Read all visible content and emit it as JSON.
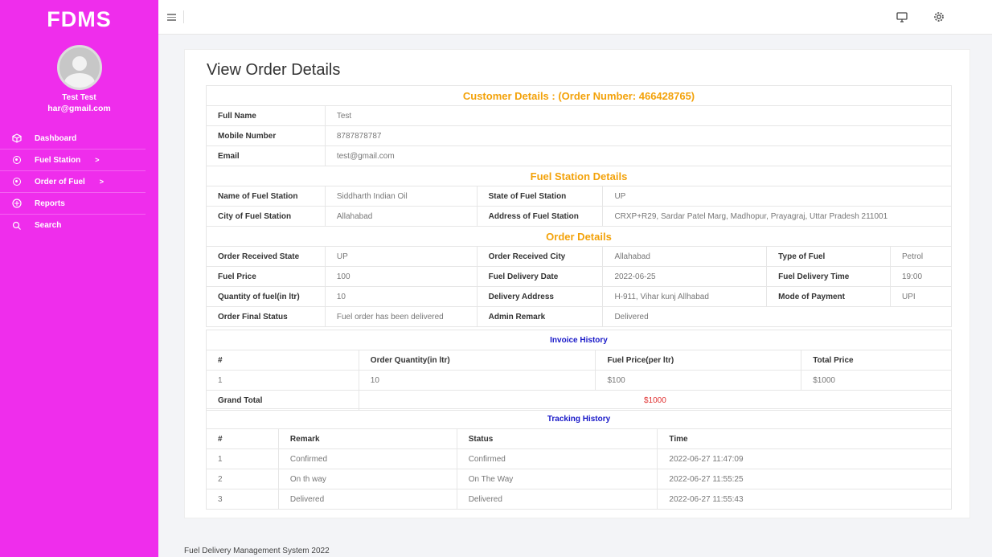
{
  "brand": "FDMS",
  "user": {
    "name": "Test Test",
    "email": "har@gmail.com"
  },
  "nav": [
    {
      "label": "Dashboard",
      "icon": "cube-icon",
      "chevron": ""
    },
    {
      "label": "Fuel Station",
      "icon": "circle-dot-icon",
      "chevron": ">"
    },
    {
      "label": "Order of Fuel",
      "icon": "circle-dot-icon",
      "chevron": ">"
    },
    {
      "label": "Reports",
      "icon": "grid-circle-icon",
      "chevron": ""
    },
    {
      "label": "Search",
      "icon": "search-icon",
      "chevron": ""
    }
  ],
  "page_title": "View Order Details",
  "customer": {
    "heading": "Customer Details : (Order Number: 466428765)",
    "rows": [
      {
        "label": "Full Name",
        "value": "Test"
      },
      {
        "label": "Mobile Number",
        "value": "8787878787"
      },
      {
        "label": "Email",
        "value": "test@gmail.com"
      }
    ]
  },
  "station": {
    "heading": "Fuel Station Details",
    "name_label": "Name of Fuel Station",
    "name": "Siddharth Indian Oil",
    "state_label": "State of Fuel Station",
    "state": "UP",
    "city_label": "City of Fuel Station",
    "city": "Allahabad",
    "address_label": "Address of Fuel Station",
    "address": "CRXP+R29, Sardar Patel Marg, Madhopur, Prayagraj, Uttar Pradesh 211001"
  },
  "order": {
    "heading": "Order Details",
    "rows": [
      [
        "Order Received State",
        "UP",
        "Order Received City",
        "Allahabad",
        "Type of Fuel",
        "Petrol"
      ],
      [
        "Fuel Price",
        "100",
        "Fuel Delivery Date",
        "2022-06-25",
        "Fuel Delivery Time",
        "19:00"
      ],
      [
        "Quantity of fuel(in ltr)",
        "10",
        "Delivery Address",
        "H-911, Vihar kunj Allhabad",
        "Mode of Payment",
        "UPI"
      ],
      [
        "Order Final Status",
        "Fuel order has been delivered",
        "Admin Remark",
        "Delivered",
        "",
        ""
      ]
    ]
  },
  "invoice": {
    "heading": "Invoice History",
    "columns": [
      "#",
      "Order Quantity(in ltr)",
      "Fuel Price(per ltr)",
      "Total Price"
    ],
    "row": [
      "1",
      "10",
      "$100",
      "$1000"
    ],
    "grand_total_label": "Grand Total",
    "grand_total": "$1000"
  },
  "tracking": {
    "heading": "Tracking History",
    "columns": [
      "#",
      "Remark",
      "Status",
      "Time"
    ],
    "rows": [
      [
        "1",
        "Confirmed",
        "Confirmed",
        "2022-06-27 11:47:09"
      ],
      [
        "2",
        "On th way",
        "On The Way",
        "2022-06-27 11:55:25"
      ],
      [
        "3",
        "Delivered",
        "Delivered",
        "2022-06-27 11:55:43"
      ]
    ]
  },
  "footer": "Fuel Delivery Management System 2022",
  "colors": {
    "sidebar": "#ef2dec",
    "section_heading": "#f3a20a",
    "sub_heading": "#1818c8",
    "grand_total": "#e03131"
  }
}
